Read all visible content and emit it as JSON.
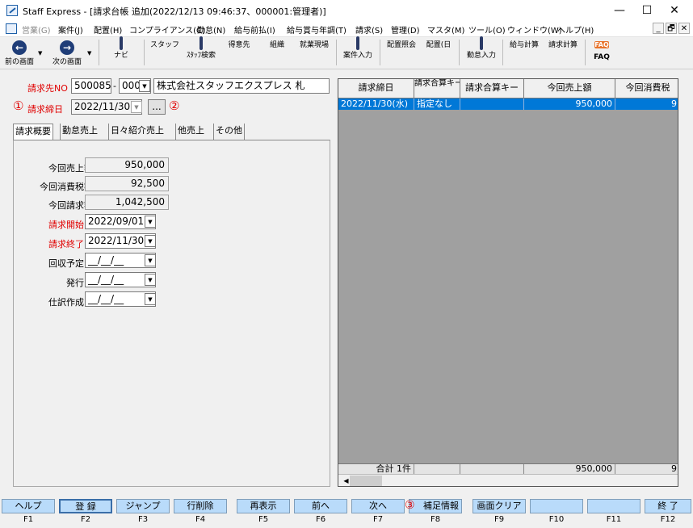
{
  "window": {
    "title": "Staff Express - [請求台帳 追加(2022/12/13 09:46:37、000001:管理者)]",
    "minimize": "—",
    "maximize": "☐",
    "close": "✕"
  },
  "menu": {
    "items": [
      "営業(G)",
      "案件(J)",
      "配置(H)",
      "コンプライアンス(C)",
      "勤怠(N)",
      "給与前払(I)",
      "給与賞与年調(T)",
      "請求(S)",
      "管理(D)",
      "マスタ(M)",
      "ツール(O)",
      "ウィンドウ(W)",
      "ヘルプ(H)"
    ],
    "mdi": [
      "_",
      "🗗",
      "✕"
    ]
  },
  "toolbar": {
    "items": [
      {
        "label": "前の画面",
        "icon": "back-arrow-icon"
      },
      {
        "label": "次の画面",
        "icon": "forward-arrow-icon"
      },
      {
        "label": "ナビ",
        "icon": "navi-icon"
      },
      {
        "label": "スタッフ",
        "icon": "staff-icon"
      },
      {
        "label": "ｽﾀｯﾌ検索",
        "icon": "staff-search-icon"
      },
      {
        "label": "得意先",
        "icon": "customer-icon"
      },
      {
        "label": "組織",
        "icon": "organization-icon"
      },
      {
        "label": "就業現場",
        "icon": "workplace-icon"
      },
      {
        "label": "案件入力",
        "icon": "project-entry-icon"
      },
      {
        "label": "配置照会",
        "icon": "assignment-query-icon"
      },
      {
        "label": "配置(日",
        "icon": "assignment-daily-icon"
      },
      {
        "label": "勤怠入力",
        "icon": "attendance-entry-icon"
      },
      {
        "label": "給与計算",
        "icon": "payroll-icon"
      },
      {
        "label": "請求計算",
        "icon": "billing-calc-icon"
      },
      {
        "label": "FAQ",
        "icon": "faq-icon"
      }
    ],
    "faq_glyph": "FAQ"
  },
  "form": {
    "billing_no_label": "請求先NO",
    "billing_no": "500085",
    "billing_sub": "000",
    "billing_name": "株式会社スタッフエクスプレス 札",
    "close_date_label": "請求締日",
    "close_date": "2022/11/30",
    "ellipsis": "...",
    "marker1": "①",
    "marker2": "②",
    "tabs": [
      "請求概要",
      "勤怠売上",
      "日々紹介売上",
      "他売上",
      "その他"
    ],
    "fields": [
      {
        "label": "今回売上額",
        "value": "950,000",
        "red": false
      },
      {
        "label": "今回消費税額",
        "value": "92,500",
        "red": false
      },
      {
        "label": "今回請求額",
        "value": "1,042,500",
        "red": false
      },
      {
        "label": "請求開始日",
        "value": "2022/09/01",
        "red": true
      },
      {
        "label": "請求終了日",
        "value": "2022/11/30",
        "red": true
      },
      {
        "label": "回収予定日",
        "value": "__/__/__",
        "red": false
      },
      {
        "label": "発行日",
        "value": "__/__/__",
        "red": false
      },
      {
        "label": "仕訳作成日",
        "value": "__/__/__",
        "red": false
      }
    ]
  },
  "grid": {
    "columns": [
      "請求締日",
      "請求合算キー区分",
      "請求合算キー",
      "今回売上額",
      "今回消費税"
    ],
    "rows": [
      [
        "2022/11/30(水)",
        "指定なし",
        "",
        "950,000",
        "9"
      ]
    ],
    "footer": [
      "合計 1件",
      "",
      "",
      "950,000",
      "9"
    ],
    "scroll_left": "◀"
  },
  "fkeys": [
    {
      "label": "ヘルプ",
      "key": "F1"
    },
    {
      "label": "登 録",
      "key": "F2"
    },
    {
      "label": "ジャンプ",
      "key": "F3"
    },
    {
      "label": "行削除",
      "key": "F4"
    },
    {
      "label": "再表示",
      "key": "F5"
    },
    {
      "label": "前へ",
      "key": "F6"
    },
    {
      "label": "次へ",
      "key": "F7"
    },
    {
      "label": "補足情報",
      "key": "F8",
      "marker": "③"
    },
    {
      "label": "画面クリア",
      "key": "F9"
    },
    {
      "label": "",
      "key": "F10"
    },
    {
      "label": "",
      "key": "F11"
    },
    {
      "label": "終 了",
      "key": "F12"
    }
  ]
}
